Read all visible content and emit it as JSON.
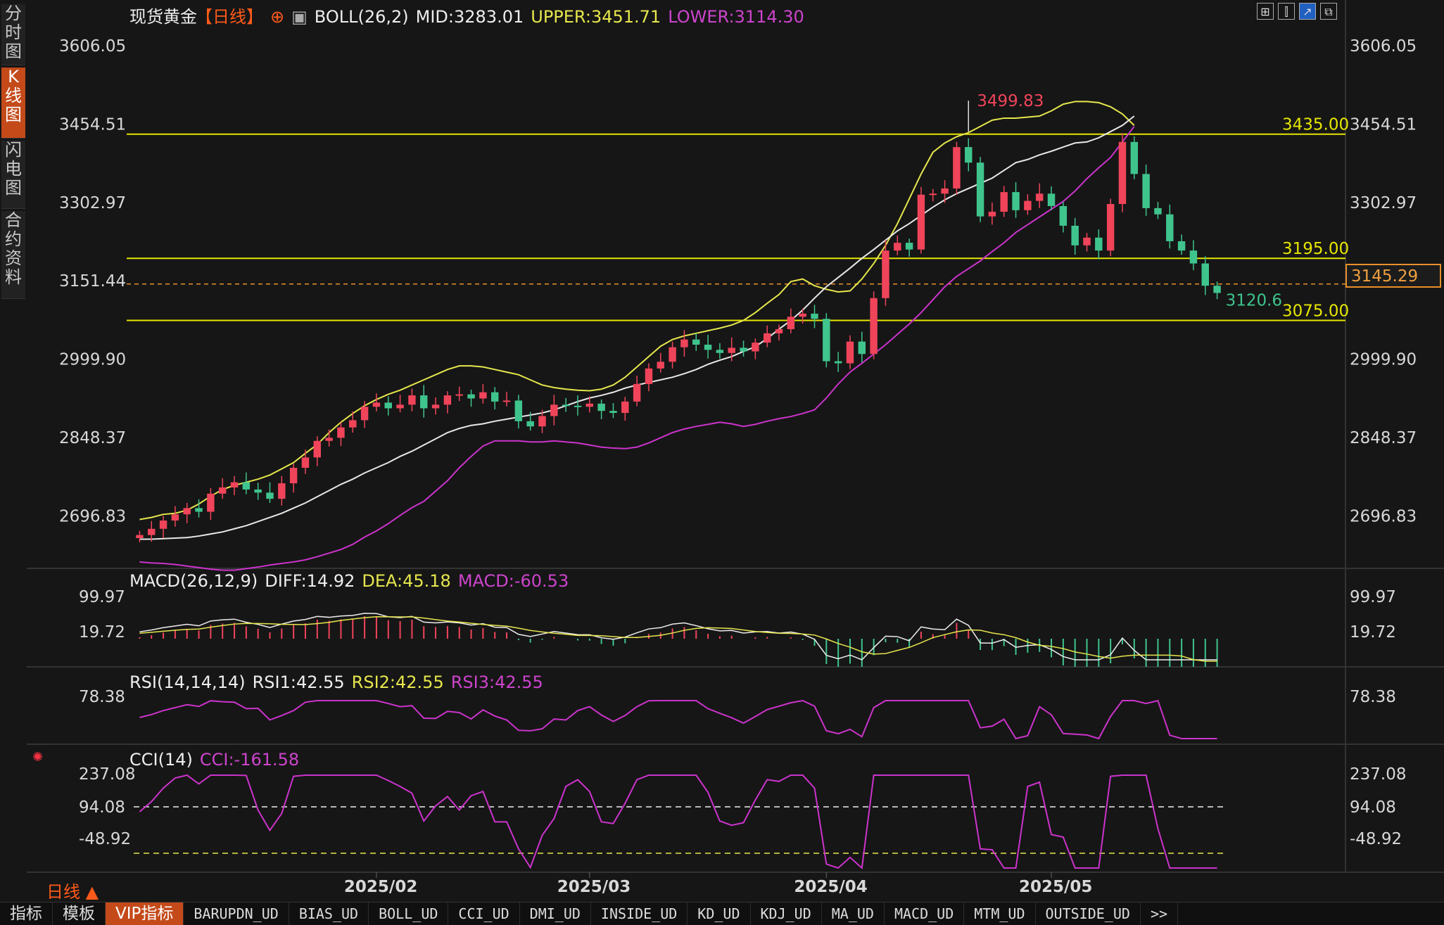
{
  "side_tabs": [
    "分时图",
    "K线图",
    "闪电图",
    "合约资料"
  ],
  "header": {
    "symbol": "现货黄金",
    "period_tag": "【日线】",
    "boll": "BOLL(26,2)",
    "mid": "MID:3283.01",
    "upper": "UPPER:3451.71",
    "lower": "LOWER:3114.30"
  },
  "corner_icons": [
    "grid-icon",
    "candle-icon",
    "line-icon",
    "restore-icon"
  ],
  "price_axis": [
    "3606.05",
    "3454.51",
    "3302.97",
    "3151.44",
    "2999.90",
    "2848.37",
    "2696.83"
  ],
  "last_price": "3145.29",
  "hlines": [
    {
      "label": "3435.00",
      "value": 3435
    },
    {
      "label": "3195.00",
      "value": 3195
    },
    {
      "label": "3075.00",
      "value": 3075
    }
  ],
  "annotations": {
    "high": "3499.83",
    "low": "3120.6"
  },
  "macd": {
    "title": "MACD(26,12,9)",
    "diff": "DIFF:14.92",
    "dea": "DEA:45.18",
    "macd": "MACD:-60.53",
    "axis": [
      "99.97",
      "19.72"
    ]
  },
  "rsi": {
    "title": "RSI(14,14,14)",
    "rsi1": "RSI1:42.55",
    "rsi2": "RSI2:42.55",
    "rsi3": "RSI3:42.55",
    "axis": [
      "78.38"
    ]
  },
  "cci": {
    "title": "CCI(14)",
    "cci": "CCI:-161.58",
    "axis": [
      "237.08",
      "94.08",
      "-48.92"
    ]
  },
  "x_labels": [
    "2025/02",
    "2025/03",
    "2025/04",
    "2025/05"
  ],
  "period": "日线",
  "bottom_tabs": [
    "指标",
    "模板",
    "VIP指标",
    "BARUPDN_UD",
    "BIAS_UD",
    "BOLL_UD",
    "CCI_UD",
    "DMI_UD",
    "INSIDE_UD",
    "KD_UD",
    "KDJ_UD",
    "MA_UD",
    "MACD_UD",
    "MTM_UD",
    "OUTSIDE_UD",
    ">>"
  ],
  "colors": {
    "up": "#f0445a",
    "down": "#3fc48d",
    "upper": "#e6e64d",
    "mid": "#e8e8e8",
    "lower": "#cc33cc",
    "hline": "#e6e600",
    "accent": "#c44a1a"
  },
  "chart_data": {
    "type": "candlestick",
    "ylim": [
      2620,
      3640
    ],
    "closes": [
      2660,
      2672,
      2688,
      2700,
      2712,
      2705,
      2740,
      2752,
      2762,
      2748,
      2742,
      2730,
      2760,
      2790,
      2810,
      2842,
      2848,
      2868,
      2882,
      2908,
      2916,
      2905,
      2912,
      2930,
      2905,
      2912,
      2930,
      2932,
      2924,
      2936,
      2918,
      2920,
      2880,
      2870,
      2890,
      2912,
      2910,
      2908,
      2914,
      2900,
      2896,
      2918,
      2952,
      2982,
      2995,
      3023,
      3038,
      3028,
      3018,
      3012,
      3022,
      3015,
      3032,
      3050,
      3058,
      3082,
      3088,
      3078,
      2996,
      2992,
      3034,
      3010,
      3118,
      3210,
      3225,
      3212,
      3318,
      3320,
      3330,
      3410,
      3380,
      3276,
      3285,
      3323,
      3288,
      3306,
      3320,
      3296,
      3258,
      3220,
      3235,
      3210,
      3300,
      3420,
      3358,
      3292,
      3280,
      3228,
      3210,
      3185,
      3142,
      3128
    ],
    "bb_upper": [
      2690,
      2694,
      2700,
      2702,
      2708,
      2720,
      2735,
      2748,
      2756,
      2762,
      2768,
      2776,
      2788,
      2800,
      2818,
      2835,
      2858,
      2878,
      2895,
      2910,
      2922,
      2932,
      2940,
      2950,
      2960,
      2970,
      2980,
      2987,
      2987,
      2985,
      2980,
      2975,
      2970,
      2960,
      2950,
      2945,
      2942,
      2940,
      2939,
      2942,
      2950,
      2965,
      2985,
      3005,
      3025,
      3038,
      3045,
      3050,
      3055,
      3060,
      3066,
      3075,
      3090,
      3108,
      3125,
      3150,
      3155,
      3142,
      3135,
      3130,
      3132,
      3155,
      3185,
      3220,
      3262,
      3310,
      3358,
      3400,
      3418,
      3430,
      3438,
      3450,
      3462,
      3466,
      3466,
      3468,
      3470,
      3480,
      3493,
      3498,
      3498,
      3496,
      3488,
      3474,
      3452
    ],
    "bb_mid": [
      2652,
      2652,
      2653,
      2654,
      2655,
      2658,
      2662,
      2666,
      2672,
      2678,
      2686,
      2694,
      2702,
      2712,
      2722,
      2734,
      2746,
      2758,
      2768,
      2780,
      2790,
      2800,
      2812,
      2822,
      2834,
      2846,
      2858,
      2866,
      2872,
      2875,
      2880,
      2884,
      2888,
      2892,
      2896,
      2902,
      2910,
      2918,
      2925,
      2930,
      2936,
      2944,
      2950,
      2955,
      2960,
      2965,
      2972,
      2980,
      2990,
      2998,
      3005,
      3015,
      3024,
      3040,
      3058,
      3075,
      3095,
      3118,
      3140,
      3158,
      3176,
      3195,
      3212,
      3230,
      3248,
      3262,
      3278,
      3294,
      3308,
      3320,
      3330,
      3340,
      3350,
      3365,
      3380,
      3386,
      3395,
      3402,
      3410,
      3418,
      3420,
      3428,
      3440,
      3452,
      3470
    ],
    "bb_lower": [
      2608,
      2606,
      2605,
      2603,
      2600,
      2597,
      2594,
      2592,
      2592,
      2595,
      2598,
      2602,
      2605,
      2608,
      2612,
      2618,
      2625,
      2632,
      2642,
      2656,
      2668,
      2682,
      2698,
      2713,
      2725,
      2745,
      2765,
      2790,
      2812,
      2832,
      2842,
      2842,
      2842,
      2840,
      2840,
      2842,
      2840,
      2838,
      2834,
      2830,
      2828,
      2827,
      2830,
      2838,
      2848,
      2858,
      2865,
      2870,
      2874,
      2878,
      2875,
      2870,
      2874,
      2880,
      2885,
      2889,
      2895,
      2902,
      2925,
      2952,
      2975,
      2992,
      3010,
      3028,
      3048,
      3068,
      3090,
      3115,
      3140,
      3160,
      3175,
      3190,
      3208,
      3225,
      3245,
      3260,
      3275,
      3290,
      3305,
      3325,
      3349,
      3370,
      3390,
      3420,
      3450
    ]
  }
}
